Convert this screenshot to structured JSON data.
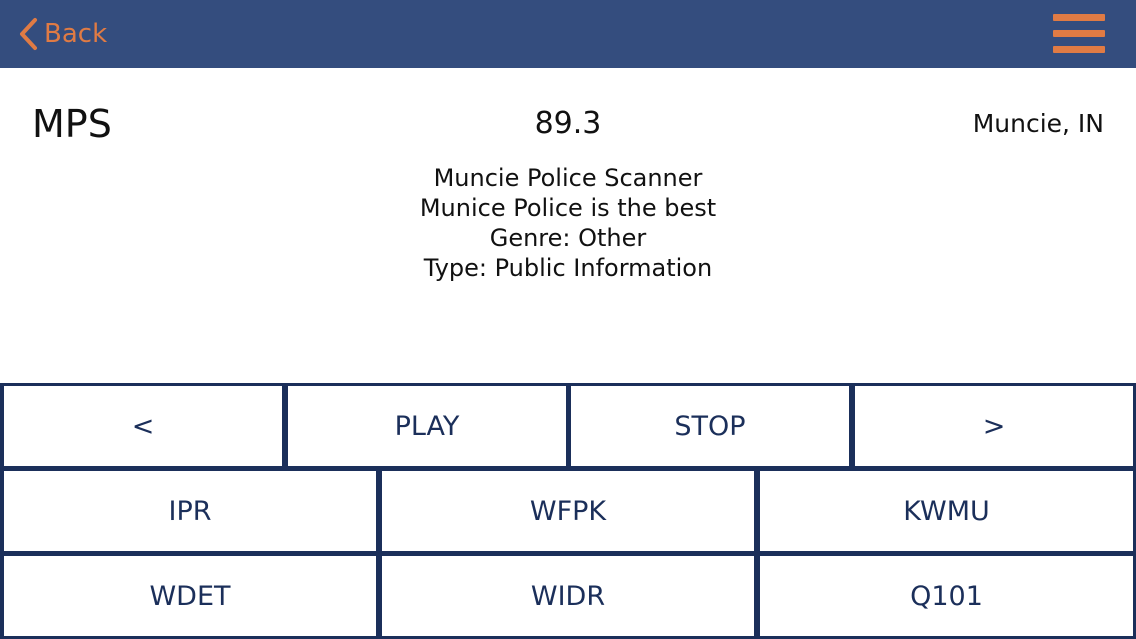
{
  "navbar": {
    "back_label": "Back",
    "back_icon": "chevron-left-icon",
    "menu_icon": "hamburger-menu-icon",
    "accent_color": "#e07b44",
    "background_color": "#344d7e"
  },
  "station": {
    "callsign": "MPS",
    "frequency": "89.3",
    "location": "Muncie, IN",
    "name": "Muncie Police Scanner",
    "description": "Munice Police is the best",
    "genre": "Genre: Other",
    "type": "Type: Public Information"
  },
  "controls": {
    "prev_label": "<",
    "play_label": "PLAY",
    "stop_label": "STOP",
    "next_label": ">"
  },
  "presets": [
    "IPR",
    "WFPK",
    "KWMU",
    "WDET",
    "WIDR",
    "Q101"
  ],
  "colors": {
    "grid_border": "#1b2f5a",
    "button_text": "#1b2f5a"
  }
}
